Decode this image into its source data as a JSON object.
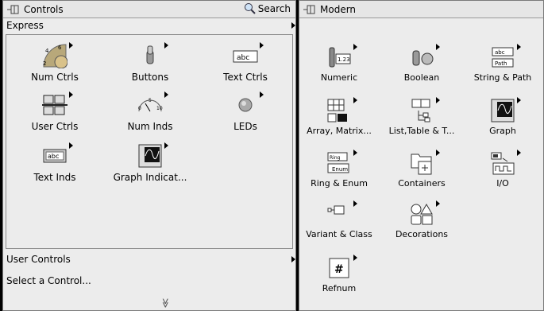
{
  "left": {
    "title": "Controls",
    "search_label": "Search",
    "express_label": "Express",
    "express_items": [
      {
        "label": "Num Ctrls",
        "icon": "numeric-control-knob-icon"
      },
      {
        "label": "Buttons",
        "icon": "toggle-switch-icon"
      },
      {
        "label": "Text Ctrls",
        "icon": "text-control-icon"
      },
      {
        "label": "User Ctrls",
        "icon": "user-controls-icon"
      },
      {
        "label": "Num Inds",
        "icon": "gauge-indicator-icon"
      },
      {
        "label": "LEDs",
        "icon": "led-icon"
      },
      {
        "label": "Text Inds",
        "icon": "text-indicator-icon"
      },
      {
        "label": "Graph Indicat...",
        "icon": "graph-indicator-icon"
      }
    ],
    "menu_items": [
      {
        "label": "User Controls"
      },
      {
        "label": "Select a Control..."
      }
    ],
    "more_glyph": "≫"
  },
  "right": {
    "title": "Modern",
    "items": [
      {
        "label": "Numeric",
        "icon": "numeric-icon"
      },
      {
        "label": "Boolean",
        "icon": "boolean-icon"
      },
      {
        "label": "String & Path",
        "icon": "string-path-icon"
      },
      {
        "label": "Array, Matrix...",
        "icon": "array-matrix-icon"
      },
      {
        "label": "List,Table & T...",
        "icon": "list-table-tree-icon"
      },
      {
        "label": "Graph",
        "icon": "graph-icon"
      },
      {
        "label": "Ring & Enum",
        "icon": "ring-enum-icon"
      },
      {
        "label": "Containers",
        "icon": "containers-icon"
      },
      {
        "label": "I/O",
        "icon": "io-icon"
      },
      {
        "label": "Variant & Class",
        "icon": "variant-class-icon"
      },
      {
        "label": "Decorations",
        "icon": "decorations-icon"
      },
      {
        "label": "Refnum",
        "icon": "refnum-icon"
      }
    ],
    "icon_text": {
      "numeric": "1.23",
      "string": "abc",
      "path": "Path",
      "ring": "Ring",
      "enum": "Enum",
      "refnum": "#",
      "text_ctrl": "abc",
      "text_ind": "abc",
      "knob_min": "4",
      "knob_max": "6",
      "knob_low": "2",
      "gauge_low": "0",
      "gauge_mid": "5",
      "gauge_high": "10"
    }
  }
}
